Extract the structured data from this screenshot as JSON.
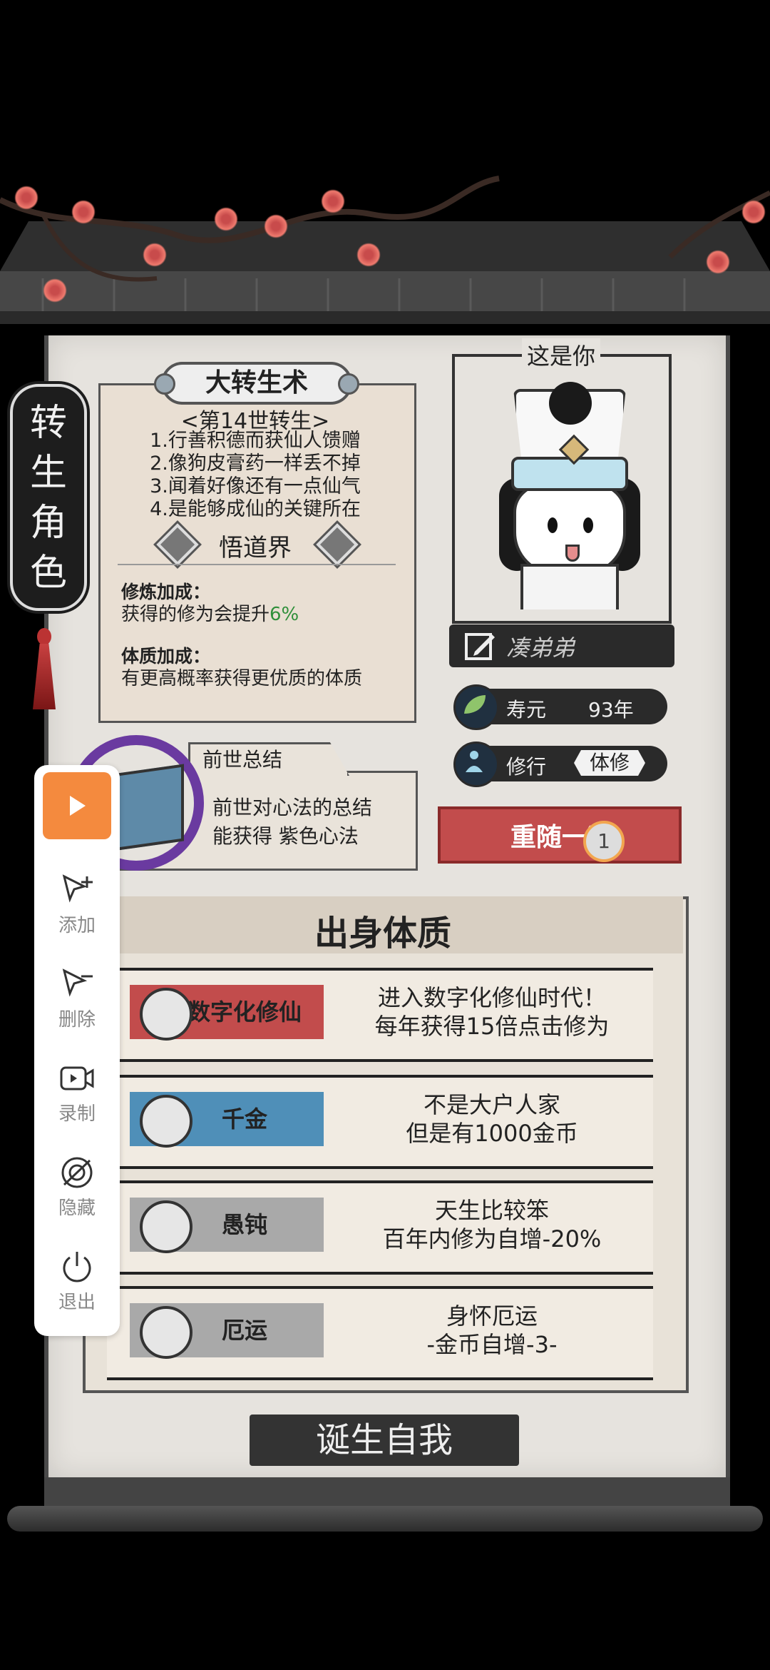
{
  "side_tag": {
    "chars": [
      "转",
      "生",
      "角",
      "色"
    ]
  },
  "rebirth_card": {
    "title": "大转生术",
    "subtitle": "<第14世转生>",
    "lines": [
      "1.行善积德而获仙人馈赠",
      "2.像狗皮膏药一样丢不掉",
      "3.闻着好像还有一点仙气",
      "4.是能够成仙的关键所在"
    ],
    "realm": "悟道界",
    "cultivation_bonus_heading": "修炼加成：",
    "cultivation_bonus_text_prefix": "获得的修为会提升",
    "cultivation_bonus_value": "6%",
    "constitution_bonus_heading": "体质加成：",
    "constitution_bonus_text": "有更高概率获得更优质的体质"
  },
  "portrait": {
    "label": "这是你"
  },
  "character": {
    "name": "凑弟弟",
    "lifespan_label": "寿元",
    "lifespan_value": "93年",
    "cultivation_label": "修行",
    "cultivation_value": "体修"
  },
  "past_life": {
    "tab_title": "前世总结",
    "line1": "前世对心法的总结",
    "line2": "能获得 紫色心法"
  },
  "reroll": {
    "label": "重随一次",
    "count": "1"
  },
  "origin": {
    "title": "出身体质",
    "traits": [
      {
        "name": "数字化修仙",
        "desc1": "进入数字化修仙时代！",
        "desc2": "每年获得15倍点击修为",
        "color": "#c24c4c",
        "icon": "fist-icon"
      },
      {
        "name": "千金",
        "desc1": "不是大户人家",
        "desc2": "但是有1000金币",
        "color": "#4f8fb8",
        "icon": "money-bag-icon"
      },
      {
        "name": "愚钝",
        "desc1": "天生比较笨",
        "desc2": "百年内修为自增-20%",
        "color": "#a9a9a9",
        "icon": "scroll-icon"
      },
      {
        "name": "厄运",
        "desc1": "身怀厄运",
        "desc2": "-金币自增-3-",
        "color": "#a9a9a9",
        "icon": "scroll-icon"
      }
    ]
  },
  "birth_button": {
    "label": "诞生自我"
  },
  "toolbar": {
    "items": [
      {
        "label": "添加",
        "icon": "add-cursor-icon"
      },
      {
        "label": "删除",
        "icon": "remove-cursor-icon"
      },
      {
        "label": "录制",
        "icon": "record-icon"
      },
      {
        "label": "隐藏",
        "icon": "hide-icon"
      },
      {
        "label": "退出",
        "icon": "power-icon"
      }
    ]
  },
  "colors": {
    "accent_green": "#2f8f3a",
    "reroll_red": "#c24c4c",
    "play_orange": "#f48a3e",
    "purple_ring": "#6a3aa0"
  }
}
